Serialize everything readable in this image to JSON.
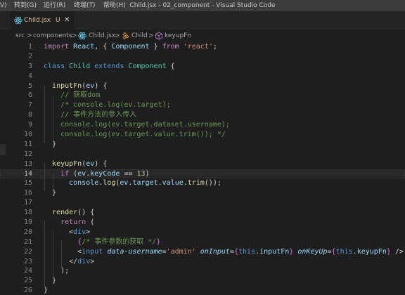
{
  "titlebar": {
    "menu": [
      "V)",
      "转到(G)",
      "运行(R)",
      "终端(T)",
      "帮助(H)"
    ],
    "window_title": "Child.jsx - 02_component - Visual Studio Code"
  },
  "tab": {
    "label": "Child.jsx",
    "status": "U",
    "close": "✕",
    "icon": "react-icon"
  },
  "breadcrumb": {
    "items": [
      "src",
      "components",
      "Child.jsx",
      "Child",
      "keyupFn"
    ],
    "separator": ">"
  },
  "editor": {
    "current_line": 14,
    "lines": [
      {
        "n": "1",
        "tokens": [
          [
            "kw",
            "import "
          ],
          [
            "var",
            "React"
          ],
          [
            "punc",
            ", { "
          ],
          [
            "var",
            "Component"
          ],
          [
            "punc",
            " } "
          ],
          [
            "kw",
            "from "
          ],
          [
            "str",
            "'react'"
          ],
          [
            "punc",
            ";"
          ]
        ]
      },
      {
        "n": "2",
        "tokens": []
      },
      {
        "n": "3",
        "tokens": [
          [
            "tag",
            "class "
          ],
          [
            "cls",
            "Child "
          ],
          [
            "tag",
            "extends "
          ],
          [
            "cls",
            "Component "
          ],
          [
            "punc",
            "{"
          ]
        ]
      },
      {
        "n": "4",
        "tokens": []
      },
      {
        "n": "5",
        "tokens": [
          [
            "punc",
            "  "
          ],
          [
            "fn",
            "inputFn"
          ],
          [
            "punc",
            "("
          ],
          [
            "var",
            "ev"
          ],
          [
            "punc",
            ") {"
          ]
        ]
      },
      {
        "n": "6",
        "tokens": [
          [
            "punc",
            "    "
          ],
          [
            "cmt",
            "// 获取dom"
          ]
        ]
      },
      {
        "n": "7",
        "tokens": [
          [
            "punc",
            "    "
          ],
          [
            "cmt",
            "/* console.log(ev.target);"
          ]
        ]
      },
      {
        "n": "8",
        "tokens": [
          [
            "punc",
            "    "
          ],
          [
            "cmt",
            "// 事件方法的参入传入"
          ]
        ]
      },
      {
        "n": "9",
        "tokens": [
          [
            "punc",
            "    "
          ],
          [
            "cmt",
            "console.log(ev.target.dataset.username);"
          ]
        ]
      },
      {
        "n": "10",
        "tokens": [
          [
            "punc",
            "    "
          ],
          [
            "cmt",
            "console.log(ev.target.value.trim()); */"
          ]
        ]
      },
      {
        "n": "11",
        "tokens": [
          [
            "punc",
            "  }"
          ]
        ]
      },
      {
        "n": "12",
        "tokens": []
      },
      {
        "n": "13",
        "tokens": [
          [
            "punc",
            "  "
          ],
          [
            "fn",
            "keyupFn"
          ],
          [
            "punc",
            "("
          ],
          [
            "var",
            "ev"
          ],
          [
            "punc",
            ") {"
          ]
        ]
      },
      {
        "n": "14",
        "tokens": [
          [
            "punc",
            "    "
          ],
          [
            "kw",
            "if "
          ],
          [
            "punc",
            "("
          ],
          [
            "var",
            "ev"
          ],
          [
            "punc",
            "."
          ],
          [
            "var",
            "keyCode"
          ],
          [
            "punc",
            " == "
          ],
          [
            "num",
            "13"
          ],
          [
            "punc",
            ")"
          ]
        ]
      },
      {
        "n": "15",
        "tokens": [
          [
            "punc",
            "      "
          ],
          [
            "var",
            "console"
          ],
          [
            "punc",
            "."
          ],
          [
            "fn",
            "log"
          ],
          [
            "punc",
            "("
          ],
          [
            "var",
            "ev"
          ],
          [
            "punc",
            "."
          ],
          [
            "var",
            "target"
          ],
          [
            "punc",
            "."
          ],
          [
            "var",
            "value"
          ],
          [
            "punc",
            "."
          ],
          [
            "fn",
            "trim"
          ],
          [
            "punc",
            "());"
          ]
        ]
      },
      {
        "n": "16",
        "tokens": [
          [
            "punc",
            "  }"
          ]
        ]
      },
      {
        "n": "17",
        "tokens": []
      },
      {
        "n": "18",
        "tokens": [
          [
            "punc",
            "  "
          ],
          [
            "fn",
            "render"
          ],
          [
            "punc",
            "() {"
          ]
        ]
      },
      {
        "n": "19",
        "tokens": [
          [
            "punc",
            "    "
          ],
          [
            "kw",
            "return "
          ],
          [
            "punc",
            "("
          ]
        ]
      },
      {
        "n": "20",
        "tokens": [
          [
            "punc",
            "      <"
          ],
          [
            "tag",
            "div"
          ],
          [
            "punc",
            ">"
          ]
        ]
      },
      {
        "n": "21",
        "tokens": [
          [
            "punc",
            "        "
          ],
          [
            "brace",
            "{"
          ],
          [
            "cmt",
            "/* 事件参数的获取 */"
          ],
          [
            "brace",
            "}"
          ]
        ]
      },
      {
        "n": "22",
        "tokens": [
          [
            "punc",
            "        <"
          ],
          [
            "tag",
            "input "
          ],
          [
            "attr",
            "data-username"
          ],
          [
            "punc",
            "="
          ],
          [
            "str",
            "'admin' "
          ],
          [
            "attr",
            "onInput"
          ],
          [
            "punc",
            "="
          ],
          [
            "brace",
            "{"
          ],
          [
            "this",
            "this"
          ],
          [
            "punc",
            "."
          ],
          [
            "var",
            "inputFn"
          ],
          [
            "brace",
            "}"
          ],
          [
            "punc",
            " "
          ],
          [
            "attr",
            "onKeyUp"
          ],
          [
            "punc",
            "="
          ],
          [
            "brace",
            "{"
          ],
          [
            "this",
            "this"
          ],
          [
            "punc",
            "."
          ],
          [
            "var",
            "keyupFn"
          ],
          [
            "brace",
            "}"
          ],
          [
            "punc",
            " />"
          ]
        ]
      },
      {
        "n": "23",
        "tokens": [
          [
            "punc",
            "      </"
          ],
          [
            "tag",
            "div"
          ],
          [
            "punc",
            ">"
          ]
        ]
      },
      {
        "n": "24",
        "tokens": [
          [
            "punc",
            "    );"
          ]
        ]
      },
      {
        "n": "25",
        "tokens": [
          [
            "punc",
            "  }"
          ]
        ]
      },
      {
        "n": "26",
        "tokens": [
          [
            "punc",
            "}"
          ]
        ]
      }
    ]
  }
}
